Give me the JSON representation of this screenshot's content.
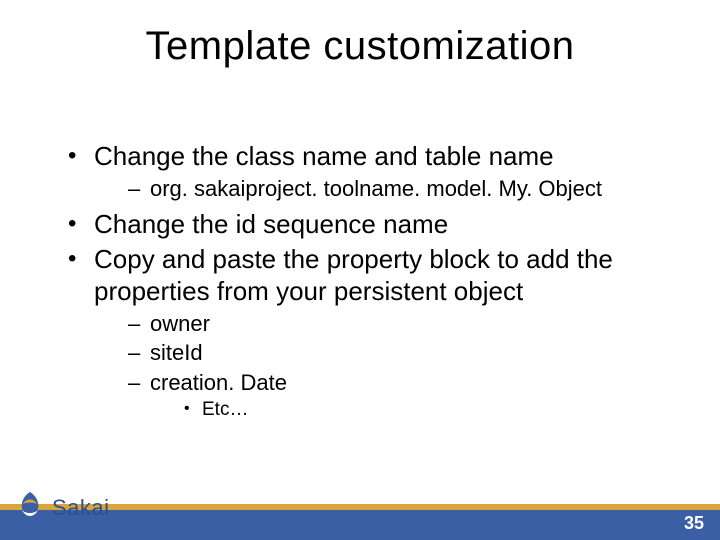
{
  "title": "Template customization",
  "bullets": {
    "b1": "Change the class name and table name",
    "b1_sub1": "org. sakaiproject. toolname. model. My. Object",
    "b2": "Change the id sequence name",
    "b3": "Copy and paste the property block to add the properties from your persistent object",
    "b3_sub1": "owner",
    "b3_sub2": "siteId",
    "b3_sub3": "creation. Date",
    "b3_sub3_sub1": "Etc…"
  },
  "logo_text": "Sakai",
  "page_number": "35"
}
